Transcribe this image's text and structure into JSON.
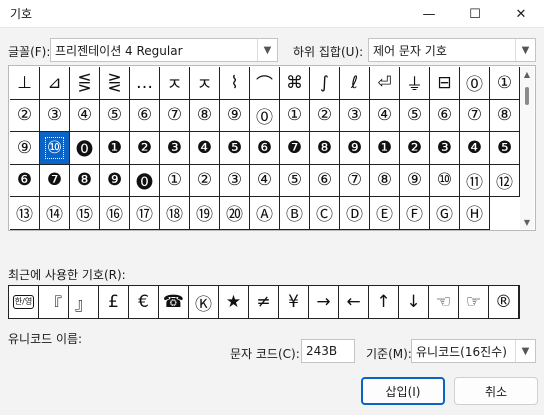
{
  "window": {
    "title": "기호",
    "minimize_glyph": "—",
    "maximize_glyph": "☐",
    "close_glyph": "✕"
  },
  "font": {
    "label": "글꼴(F):",
    "value": "프리젠테이션 4 Regular"
  },
  "subset": {
    "label": "하위 집합(U):",
    "value": "제어 문자 기호"
  },
  "symbol_rows": [
    [
      "⊥",
      "⊿",
      "⋚",
      "⋛",
      "…",
      "ㅈ",
      "ㅈ",
      "⌇",
      "⌒",
      "⌘",
      "∫",
      "ℓ",
      "⏎",
      "⏚",
      "⊟",
      "⓪",
      "①"
    ],
    [
      "②",
      "③",
      "④",
      "⑤",
      "⑥",
      "⑦",
      "⑧",
      "⑨",
      "⓪",
      "①",
      "②",
      "③",
      "④",
      "⑤",
      "⑥",
      "⑦",
      "⑧"
    ],
    [
      "⑨",
      "⑩",
      "⓿",
      "❶",
      "❷",
      "❸",
      "❹",
      "❺",
      "❻",
      "❼",
      "❽",
      "❾",
      "❶",
      "❷",
      "❸",
      "❹"
    ],
    [
      "❺",
      "❻",
      "❼",
      "❽",
      "❾",
      "⓿",
      "①",
      "②",
      "③",
      "④",
      "⑤",
      "⑥",
      "⑦",
      "⑧",
      "⑨",
      "⑩",
      "⑪"
    ],
    [
      "⑫",
      "⑬",
      "⑭",
      "⑮",
      "⑯",
      "⑰",
      "⑱",
      "⑲",
      "⑳",
      "Ⓐ",
      "Ⓑ",
      "Ⓒ",
      "Ⓓ",
      "Ⓔ",
      "Ⓕ",
      "Ⓖ",
      "Ⓗ"
    ]
  ],
  "selected_symbol": "⑩",
  "recent": {
    "label": "최근에 사용한 기호(R):",
    "symbols": [
      "한/영",
      "『",
      "』",
      "£",
      "€",
      "☎",
      "Ⓚ",
      "★",
      "≠",
      "¥",
      "→",
      "←",
      "↑",
      "↓",
      "☜",
      "☞",
      "®"
    ]
  },
  "unicode_name": {
    "label": "유니코드 이름:"
  },
  "char_code": {
    "label": "문자 코드(C):",
    "value": "243B"
  },
  "basis": {
    "label": "기준(M):",
    "value": "유니코드(16진수)"
  },
  "buttons": {
    "insert": "삽입(I)",
    "cancel": "취소"
  },
  "colors": {
    "selection": "#0a64c8",
    "background": "#f3f3f3"
  }
}
